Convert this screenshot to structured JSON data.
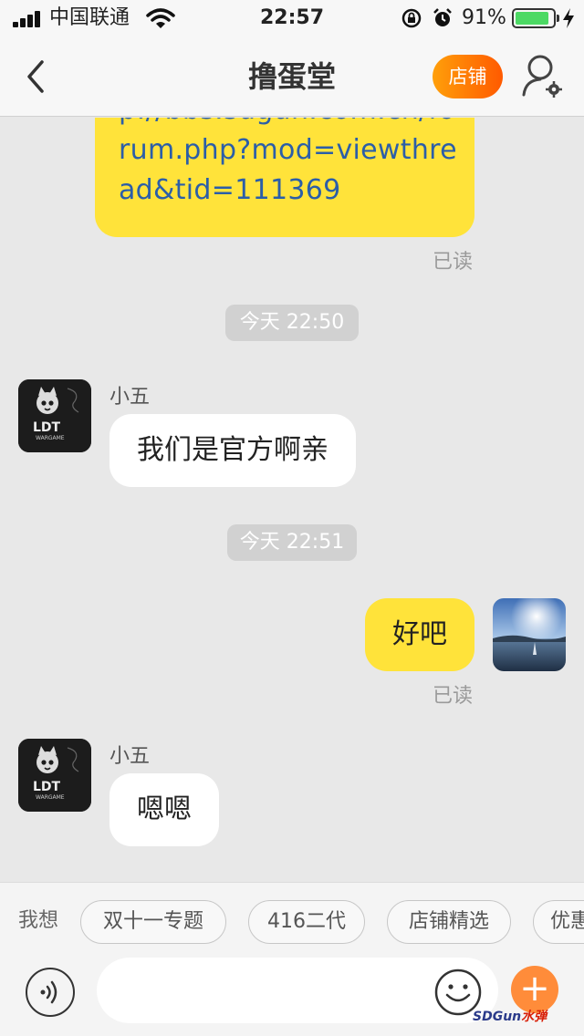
{
  "status_bar": {
    "carrier": "中国联通",
    "time": "22:57",
    "battery_percent": "91%",
    "battery_level": 0.91,
    "accent_green": "#4cd964",
    "icons": [
      "signal-icon",
      "wifi-icon",
      "orientation-lock-icon",
      "alarm-icon",
      "battery-icon",
      "charging-icon"
    ]
  },
  "nav": {
    "title": "撸蛋堂",
    "shop_label": "店铺",
    "shop_color": "#ff7a00",
    "icons": [
      "back-arrow-icon",
      "profile-settings-icon"
    ]
  },
  "messages": {
    "link_lines": [
      "p://bbs.sdgun.com.cn/fo",
      "rum.php?mod=viewthre",
      "ad&tid=111369"
    ],
    "read_label": "已读",
    "time_1": "今天 22:50",
    "sender_1": "小五",
    "text_1": "我们是官方啊亲",
    "time_2": "今天 22:51",
    "text_2": "好吧",
    "read_label_2": "已读",
    "sender_2": "小五",
    "text_3": "嗯嗯",
    "bubble_yellow": "#ffe33a",
    "link_color": "#2b5ea8",
    "avatar_text": "LDT",
    "avatar_subtext": "WARGAME"
  },
  "quick_bar": {
    "label": "我想",
    "chips": [
      "双十一专题",
      "416二代",
      "店铺精选",
      "优惠"
    ]
  },
  "input_bar": {
    "icons": [
      "voice-icon",
      "emoji-icon",
      "plus-icon"
    ],
    "plus_label": "+"
  },
  "watermark": {
    "text": "SDGun",
    "text_red": "水弹"
  }
}
